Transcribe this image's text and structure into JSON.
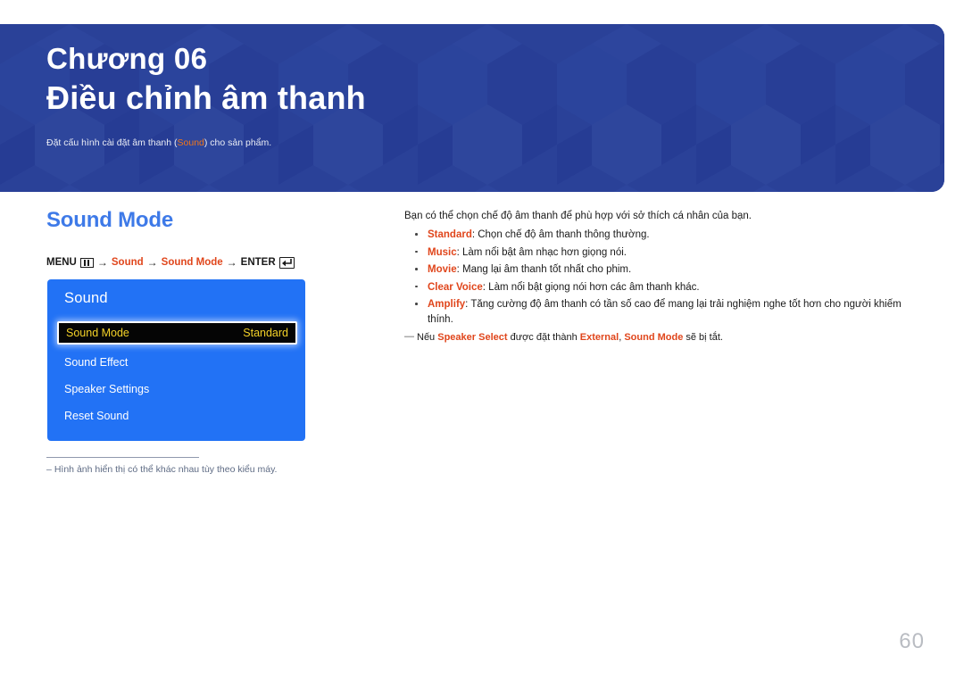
{
  "header": {
    "chapter": "Chương 06",
    "title": "Điều chỉnh âm thanh",
    "subtitle_before": "Đặt cấu hình cài đặt âm thanh (",
    "subtitle_highlight": "Sound",
    "subtitle_after": ") cho sản phẩm.",
    "bg_color": "#2a4199",
    "highlight_color": "#f0761a"
  },
  "section": {
    "title": "Sound Mode",
    "title_color": "#3e7ae8"
  },
  "menu_path": {
    "menu_label": "MENU",
    "menu_icon": "menu-bars-icon",
    "arrow": "→",
    "step1": "Sound",
    "step2": "Sound Mode",
    "enter_label": "ENTER",
    "enter_icon": "enter-return-icon",
    "accent_color": "#e0461c"
  },
  "osd": {
    "title": "Sound",
    "panel_color": "#2272f5",
    "selected_text_color": "#f4d228",
    "rows": [
      {
        "label": "Sound Mode",
        "value": "Standard",
        "selected": true
      },
      {
        "label": "Sound Effect",
        "value": "",
        "selected": false
      },
      {
        "label": "Speaker Settings",
        "value": "",
        "selected": false
      },
      {
        "label": "Reset Sound",
        "value": "",
        "selected": false
      }
    ]
  },
  "image_footnote": {
    "dash": "–",
    "text": "Hình ảnh hiển thị có thể khác nhau tùy theo kiểu máy."
  },
  "content": {
    "intro": "Bạn có thể chọn chế độ âm thanh để phù hợp với sở thích cá nhân của bạn.",
    "bullets": [
      {
        "term": "Standard",
        "desc": ": Chọn chế độ âm thanh thông thường."
      },
      {
        "term": "Music",
        "desc": ": Làm nổi bật âm nhạc hơn giọng nói."
      },
      {
        "term": "Movie",
        "desc": ": Mang lại âm thanh tốt nhất cho phim."
      },
      {
        "term": "Clear Voice",
        "desc": ": Làm nổi bật giọng nói hơn các âm thanh khác."
      },
      {
        "term": "Amplify",
        "desc": ": Tăng cường độ âm thanh có tần số cao để mang lại trải nghiệm nghe tốt hơn cho người khiếm thính."
      }
    ],
    "note": {
      "emdash": "―",
      "part1": "Nếu ",
      "term1": "Speaker Select",
      "part2": " được đặt thành ",
      "term2": "External",
      "part3": ", ",
      "term3": "Sound Mode",
      "part4": " sẽ bị tắt."
    }
  },
  "page_number": "60"
}
